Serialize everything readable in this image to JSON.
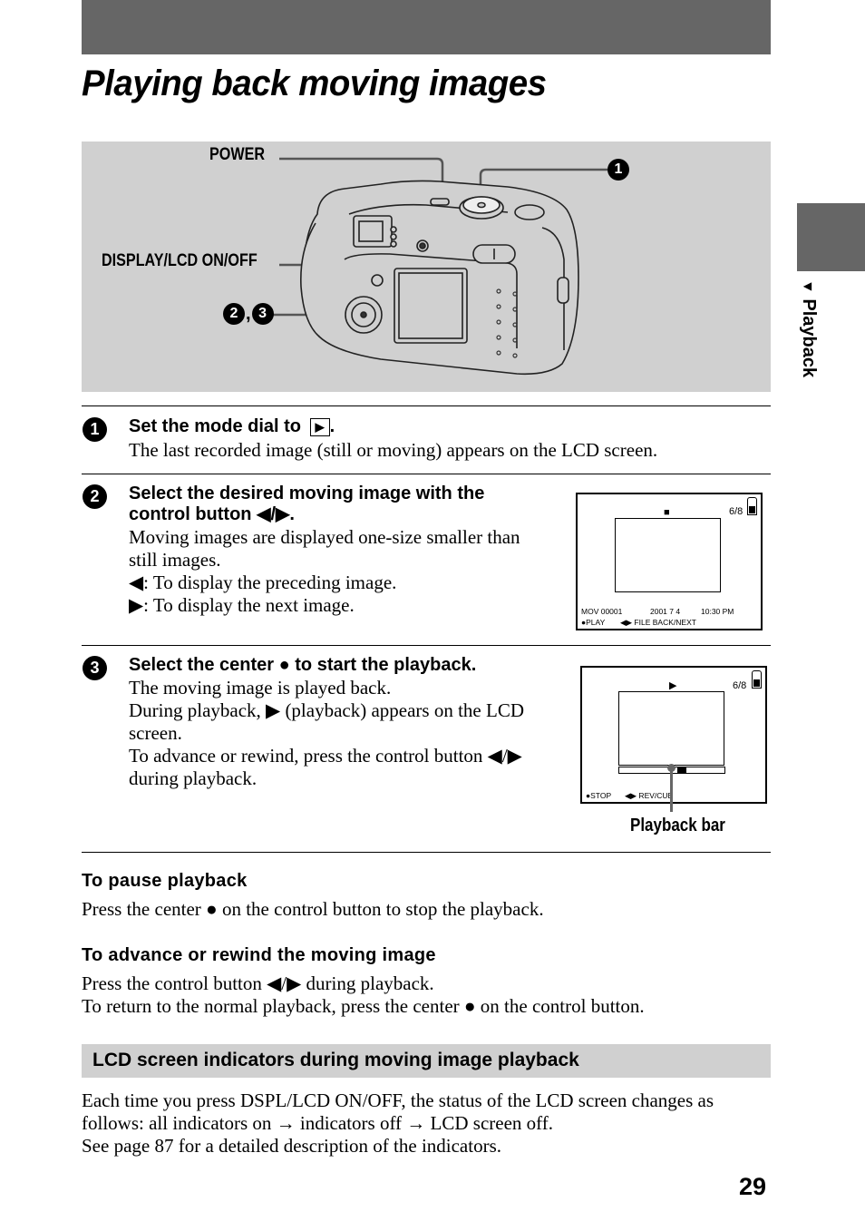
{
  "page": {
    "title": "Playing back moving images",
    "number": "29",
    "side_tab": "Playback",
    "side_tab_marker": "▼"
  },
  "illustration": {
    "callouts": {
      "power": "POWER",
      "display": "DISPLAY/LCD ON/OFF",
      "step1": "1",
      "step2": "2",
      "step3": "3",
      "separator": ","
    }
  },
  "steps": [
    {
      "number": "1",
      "heading": "Set the mode dial to",
      "heading_icon": "▶",
      "heading_suffix": ".",
      "body": [
        "The last recorded image (still or moving) appears on the LCD screen."
      ]
    },
    {
      "number": "2",
      "heading_line1": "Select the desired moving image with the",
      "heading_line2": "control button ◀/▶.",
      "body": [
        "Moving images are displayed one-size smaller than",
        "still images.",
        "◀: To display the preceding image.",
        "▶: To display the next image."
      ],
      "lcd": {
        "status_icon": "■",
        "counter": "6/8",
        "file": "MOV 00001",
        "date": "2001   7   4",
        "time": "10:30 PM",
        "hint_center": "●PLAY",
        "hint_arrows": "◀▶ FILE BACK/NEXT"
      }
    },
    {
      "number": "3",
      "heading": "Select the center ● to start the playback.",
      "body": [
        "The moving image is played back.",
        "During playback, ▶ (playback) appears on the LCD",
        "screen.",
        "To advance or rewind, press the control button ◀/▶",
        "during playback."
      ],
      "lcd": {
        "status_icon": "▶",
        "counter": "6/8",
        "hint_center": "●STOP",
        "hint_arrows": "◀▶ REV/CUE",
        "playback_progress": 0.6,
        "callout": "Playback bar"
      }
    }
  ],
  "pause": {
    "heading": "To pause playback",
    "body": "Press the center ● on the control button to stop the playback."
  },
  "advance": {
    "heading": "To advance or rewind the moving image",
    "body": [
      "Press the control button ◀/▶ during playback.",
      "To return to the normal playback, press the center ● on the control button."
    ]
  },
  "lcd_section": {
    "title": "LCD screen indicators during moving image playback",
    "body": [
      "Each time you press DSPL/LCD ON/OFF, the status of the LCD screen changes as",
      "follows: all indicators on → indicators off → LCD screen off.",
      "See page 87 for a detailed description of the indicators."
    ]
  }
}
